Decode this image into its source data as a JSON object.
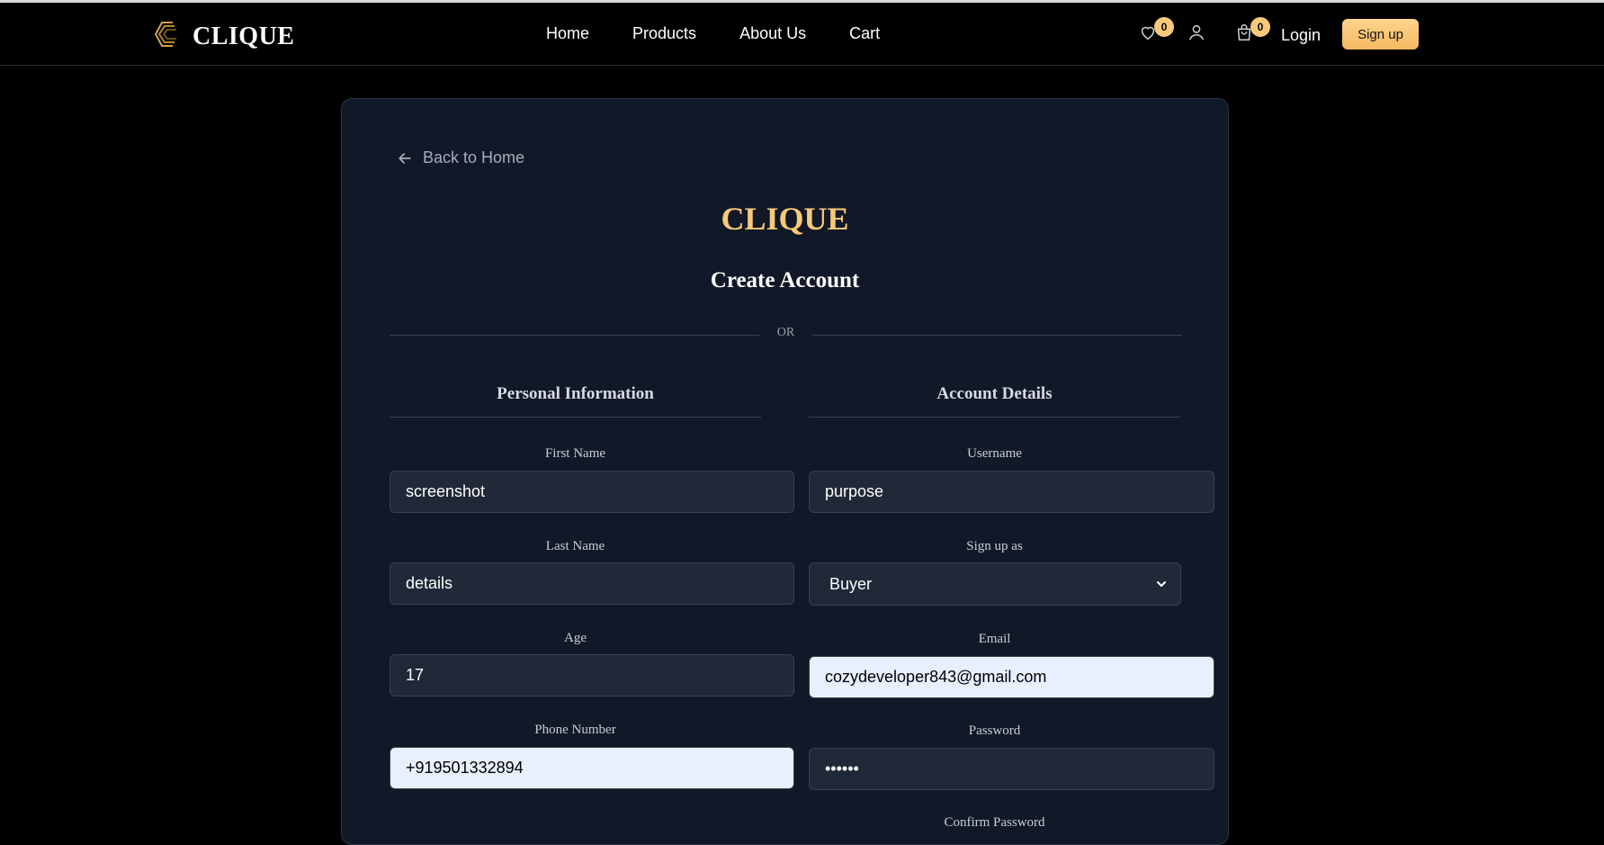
{
  "brand": {
    "name": "CLIQUE"
  },
  "nav": {
    "links": [
      "Home",
      "Products",
      "About Us",
      "Cart"
    ]
  },
  "header": {
    "wishlist_count": "0",
    "cart_count": "0",
    "login_label": "Login",
    "signup_label": "Sign up"
  },
  "form": {
    "back_label": "Back to Home",
    "logo": "CLIQUE",
    "title": "Create Account",
    "divider": "OR",
    "sections": {
      "personal": "Personal Information",
      "account": "Account Details"
    },
    "labels": {
      "first_name": "First Name",
      "last_name": "Last Name",
      "age": "Age",
      "phone": "Phone Number",
      "username": "Username",
      "signup_as": "Sign up as",
      "email": "Email",
      "password": "Password",
      "confirm_password": "Confirm Password"
    },
    "values": {
      "first_name": "screenshot",
      "last_name": "details",
      "age": "17",
      "phone": "+919501332894",
      "username": "purpose",
      "signup_as": "Buyer",
      "email": "cozydeveloper843@gmail.com",
      "password": "••••••"
    }
  },
  "colors": {
    "accent": "#f8c97a",
    "card_bg": "#111827",
    "input_bg": "#1f2937",
    "autofill_bg": "#e8f0fe"
  }
}
